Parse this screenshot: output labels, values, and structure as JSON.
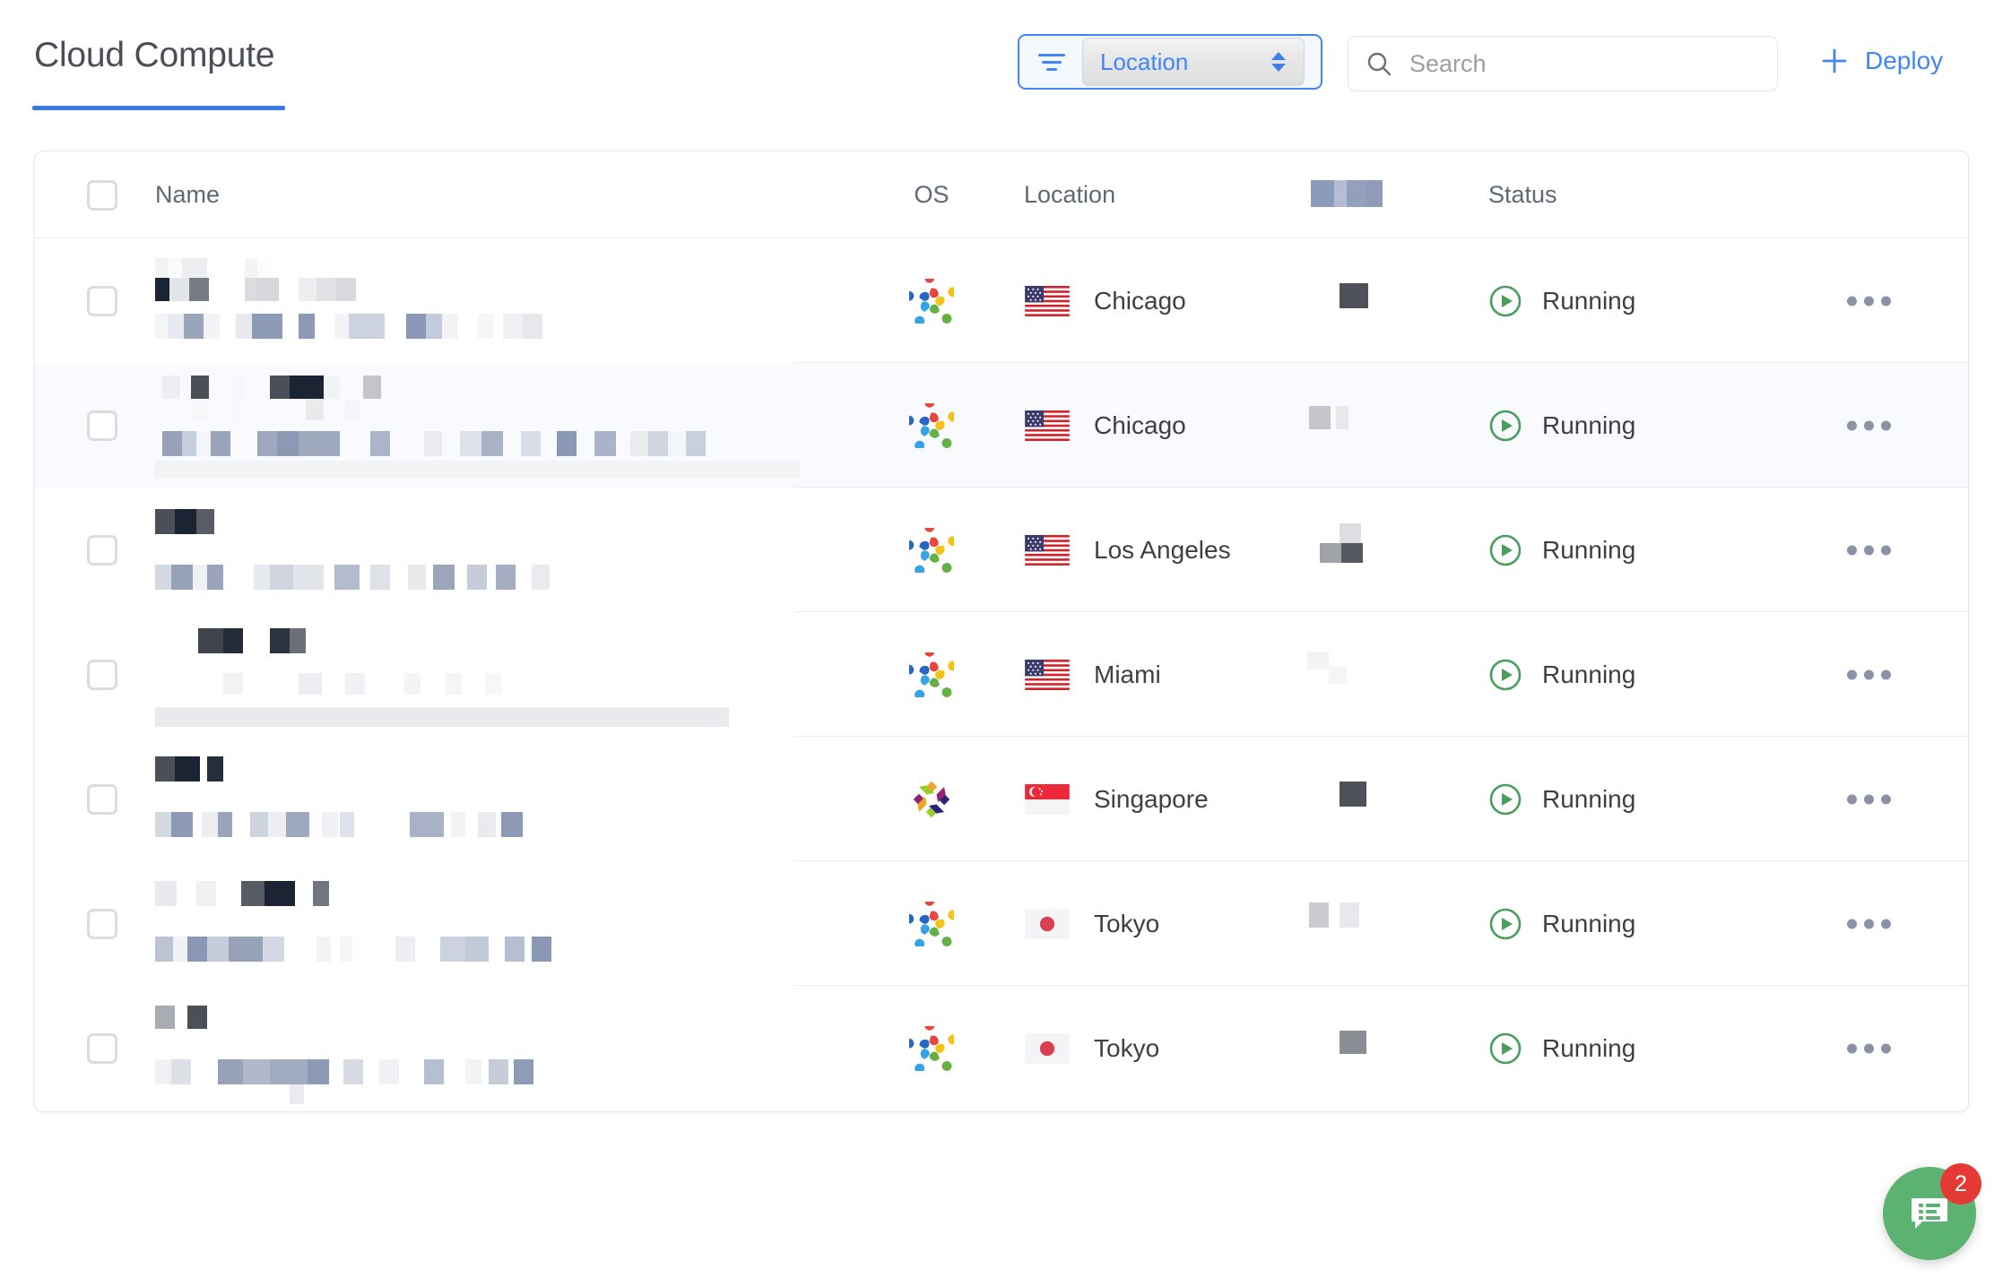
{
  "header": {
    "title": "Cloud Compute",
    "filter": {
      "icon": "filter-icon",
      "selected": "Location"
    },
    "search": {
      "icon": "search-icon",
      "placeholder": "Search"
    },
    "deploy": {
      "icon": "plus-icon",
      "label": "Deploy"
    }
  },
  "table": {
    "columns": [
      {
        "key": "select",
        "label": ""
      },
      {
        "key": "name",
        "label": "Name"
      },
      {
        "key": "os",
        "label": "OS"
      },
      {
        "key": "location",
        "label": "Location"
      },
      {
        "key": "redacted",
        "label": ""
      },
      {
        "key": "status",
        "label": "Status"
      }
    ],
    "rows": [
      {
        "name": "[redacted]",
        "os_icon": "almalinux-logo-icon",
        "flag": "flag-us-icon",
        "location": "Chicago",
        "redacted_value": "[redacted]",
        "status": "Running",
        "status_icon": "play-circle-icon",
        "menu_icon": "more-options-icon",
        "highlighted": false
      },
      {
        "name": "[redacted]",
        "os_icon": "almalinux-logo-icon",
        "flag": "flag-us-icon",
        "location": "Chicago",
        "redacted_value": "[redacted]",
        "status": "Running",
        "status_icon": "play-circle-icon",
        "menu_icon": "more-options-icon",
        "highlighted": true
      },
      {
        "name": "[redacted]",
        "os_icon": "almalinux-logo-icon",
        "flag": "flag-us-icon",
        "location": "Los Angeles",
        "redacted_value": "[redacted]",
        "status": "Running",
        "status_icon": "play-circle-icon",
        "menu_icon": "more-options-icon",
        "highlighted": false
      },
      {
        "name": "[redacted]",
        "os_icon": "almalinux-logo-icon",
        "flag": "flag-us-icon",
        "location": "Miami",
        "redacted_value": "[redacted]",
        "status": "Running",
        "status_icon": "play-circle-icon",
        "menu_icon": "more-options-icon",
        "highlighted": false
      },
      {
        "name": "[redacted]",
        "os_icon": "centos-logo-icon",
        "flag": "flag-sg-icon",
        "location": "Singapore",
        "redacted_value": "[redacted]",
        "status": "Running",
        "status_icon": "play-circle-icon",
        "menu_icon": "more-options-icon",
        "highlighted": false
      },
      {
        "name": "[redacted]",
        "os_icon": "almalinux-logo-icon",
        "flag": "flag-jp-icon",
        "location": "Tokyo",
        "redacted_value": "[redacted]",
        "status": "Running",
        "status_icon": "play-circle-icon",
        "menu_icon": "more-options-icon",
        "highlighted": false
      },
      {
        "name": "[redacted]",
        "os_icon": "almalinux-logo-icon",
        "flag": "flag-jp-icon",
        "location": "Tokyo",
        "redacted_value": "[redacted]",
        "status": "Running",
        "status_icon": "play-circle-icon",
        "menu_icon": "more-options-icon",
        "highlighted": false
      }
    ]
  },
  "chat_widget": {
    "icon": "chat-list-icon",
    "badge_count": "2"
  },
  "colors": {
    "accent_blue": "#4285f4",
    "status_green": "#4a9e5c",
    "badge_red": "#e53935",
    "fab_green": "#5cb270",
    "text_dark": "#3c4043",
    "text_muted": "#5f6876"
  }
}
